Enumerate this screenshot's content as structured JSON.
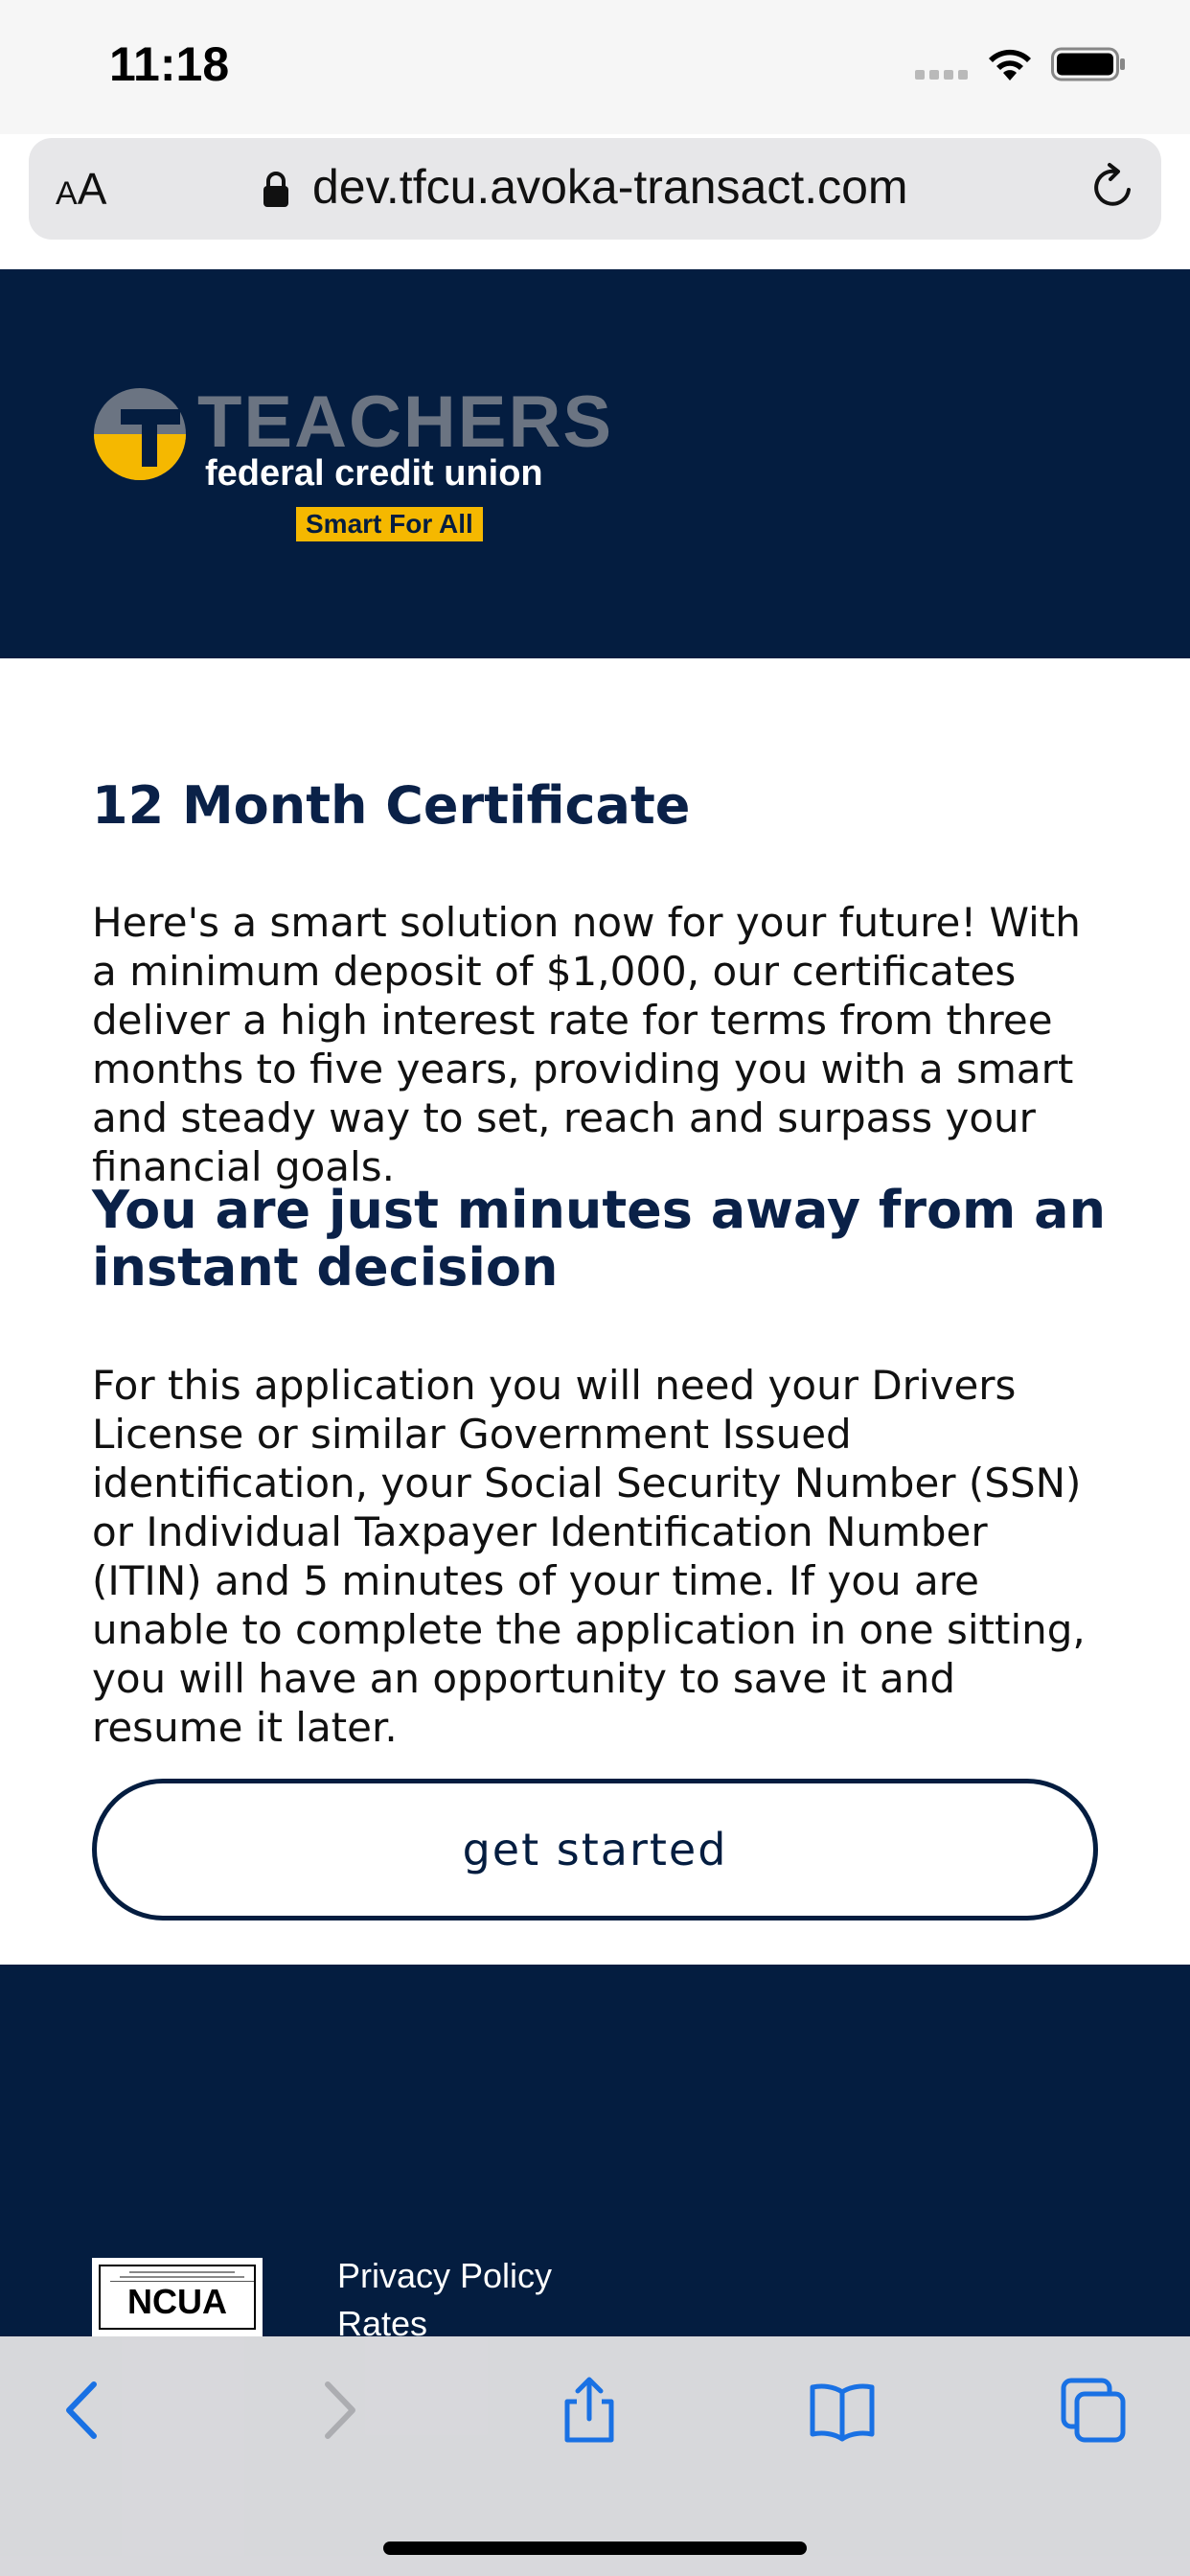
{
  "status_bar": {
    "time": "11:18"
  },
  "browser": {
    "text_size_label_small": "A",
    "text_size_label_large": "A",
    "url": "dev.tfcu.avoka-transact.com"
  },
  "logo": {
    "brand": "TEACHERS",
    "sub": "federal credit union",
    "tagline": "Smart For All",
    "colors": {
      "mark_top": "#6b7482",
      "mark_bottom": "#f5b800"
    }
  },
  "main": {
    "title": "12 Month Certificate",
    "intro": "Here's a smart solution now for your future! With a minimum deposit of $1,000, our certificates deliver a high interest rate for terms from three months to five years, providing you with a smart and steady way to set, reach and surpass your financial goals.",
    "subtitle": "You are just minutes away from an instant decision",
    "body": "For this application you will need your Drivers License or similar Government Issued identification, your Social Security Number (SSN) or Individual Taxpayer Identification Number (ITIN) and 5 minutes of your time. If you are unable to complete the application in one sitting, you will have an opportunity to save it and resume it later.",
    "start_button": "get started"
  },
  "footer": {
    "ncua_label": "NCUA",
    "links": [
      "Privacy Policy",
      "Rates"
    ]
  },
  "colors": {
    "navy": "#041d40",
    "heading": "#0a2148",
    "ios_blue": "#1a73e8"
  },
  "toolbar": {
    "icons": [
      "back-icon",
      "forward-icon",
      "share-icon",
      "bookmarks-icon",
      "tabs-icon"
    ]
  }
}
